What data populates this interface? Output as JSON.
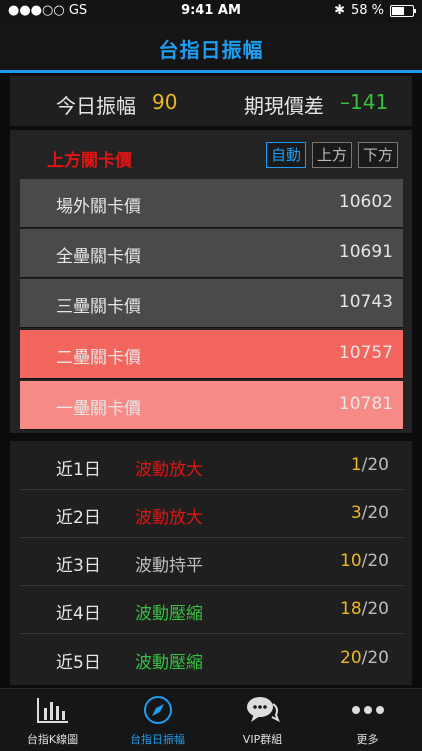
{
  "status": {
    "carrier": "●●●○○ GS",
    "time": "9:41 AM",
    "battery": "58 %"
  },
  "nav": {
    "title": "台指日振幅"
  },
  "summary": {
    "range_label": "今日振幅",
    "range_value": "90",
    "spread_label": "期現價差",
    "spread_value": "–141"
  },
  "levels": {
    "title": "上方關卡價",
    "modes": [
      "自動",
      "上方",
      "下方"
    ],
    "rows": [
      {
        "name": "場外關卡價",
        "value": "10602",
        "bg": "#4a4a4a"
      },
      {
        "name": "全壘關卡價",
        "value": "10691",
        "bg": "#4a4a4a"
      },
      {
        "name": "三壘關卡價",
        "value": "10743",
        "bg": "#4a4a4a"
      },
      {
        "name": "二壘關卡價",
        "value": "10757",
        "bg": "#f2665e"
      },
      {
        "name": "一壘關卡價",
        "value": "10781",
        "bg": "#f58a86"
      }
    ]
  },
  "stats": [
    {
      "day": "近1日",
      "state": "波動放大",
      "count": "1",
      "total": "/20",
      "state_color": "#e01414"
    },
    {
      "day": "近2日",
      "state": "波動放大",
      "count": "3",
      "total": "/20",
      "state_color": "#e01414"
    },
    {
      "day": "近3日",
      "state": "波動持平",
      "count": "10",
      "total": "/20",
      "state_color": "#bdbdbd"
    },
    {
      "day": "近4日",
      "state": "波動壓縮",
      "count": "18",
      "total": "/20",
      "state_color": "#35c13f"
    },
    {
      "day": "近5日",
      "state": "波動壓縮",
      "count": "20",
      "total": "/20",
      "state_color": "#35c13f"
    }
  ],
  "tabs": [
    {
      "label": "台指K線圖",
      "icon": "bar-chart-icon"
    },
    {
      "label": "台指日振幅",
      "icon": "compass-icon"
    },
    {
      "label": "VIP群組",
      "icon": "chat-icon"
    },
    {
      "label": "更多",
      "icon": "more-icon"
    }
  ],
  "colors": {
    "accent": "#1e9cf0",
    "yellow": "#ebb724",
    "green": "#35c13f",
    "red": "#e01414"
  }
}
